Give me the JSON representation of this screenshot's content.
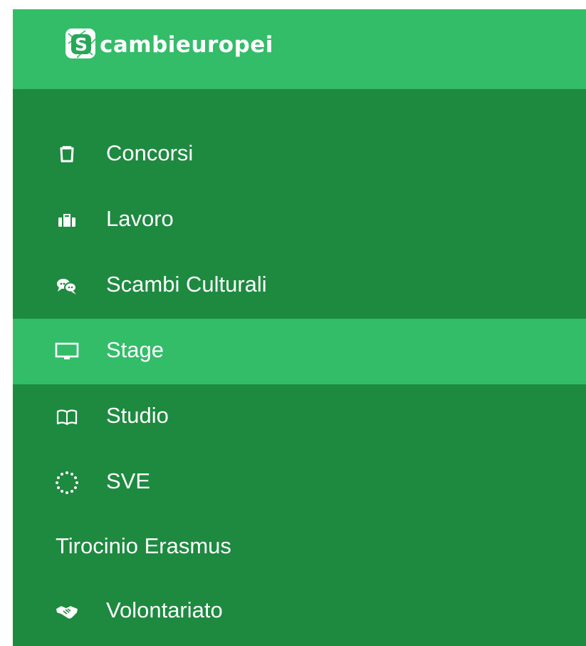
{
  "brand": {
    "logo_text": "cambieuropei",
    "logo_mark_letter": "S",
    "header_color": "#33bd68",
    "panel_color": "#1e8a40",
    "active_color": "#33bd68"
  },
  "menu": {
    "items": [
      {
        "label": "Concorsi",
        "icon": "clipboard-icon",
        "active": false
      },
      {
        "label": "Lavoro",
        "icon": "briefcase-icon",
        "active": false
      },
      {
        "label": "Scambi Culturali",
        "icon": "chat-bubbles-icon",
        "active": false
      },
      {
        "label": "Stage",
        "icon": "monitor-icon",
        "active": true
      },
      {
        "label": "Studio",
        "icon": "open-book-icon",
        "active": false
      },
      {
        "label": "SVE",
        "icon": "eu-stars-icon",
        "active": false
      },
      {
        "label": "Tirocinio Erasmus",
        "icon": "",
        "active": false
      },
      {
        "label": "Volontariato",
        "icon": "handshake-icon",
        "active": false
      }
    ]
  }
}
